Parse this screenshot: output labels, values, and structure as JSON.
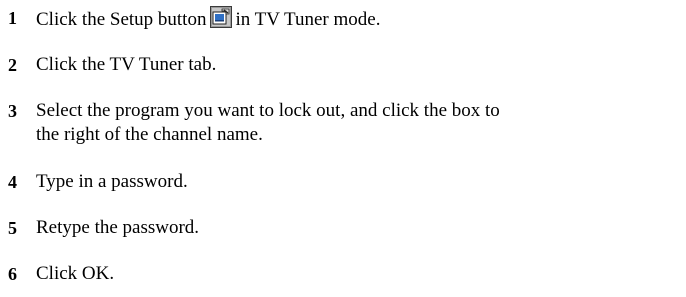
{
  "steps": [
    {
      "number": "1",
      "text_before": "Click the Setup button",
      "icon": "setup-icon",
      "text_after": "in TV Tuner mode."
    },
    {
      "number": "2",
      "text": "Click the TV Tuner tab."
    },
    {
      "number": "3",
      "line1": "Select the program you want to lock out, and click the box to",
      "line2": "the right of the channel name."
    },
    {
      "number": "4",
      "text": "Type in a password."
    },
    {
      "number": "5",
      "text": "Retype the password."
    },
    {
      "number": "6",
      "text": "Click OK."
    }
  ]
}
